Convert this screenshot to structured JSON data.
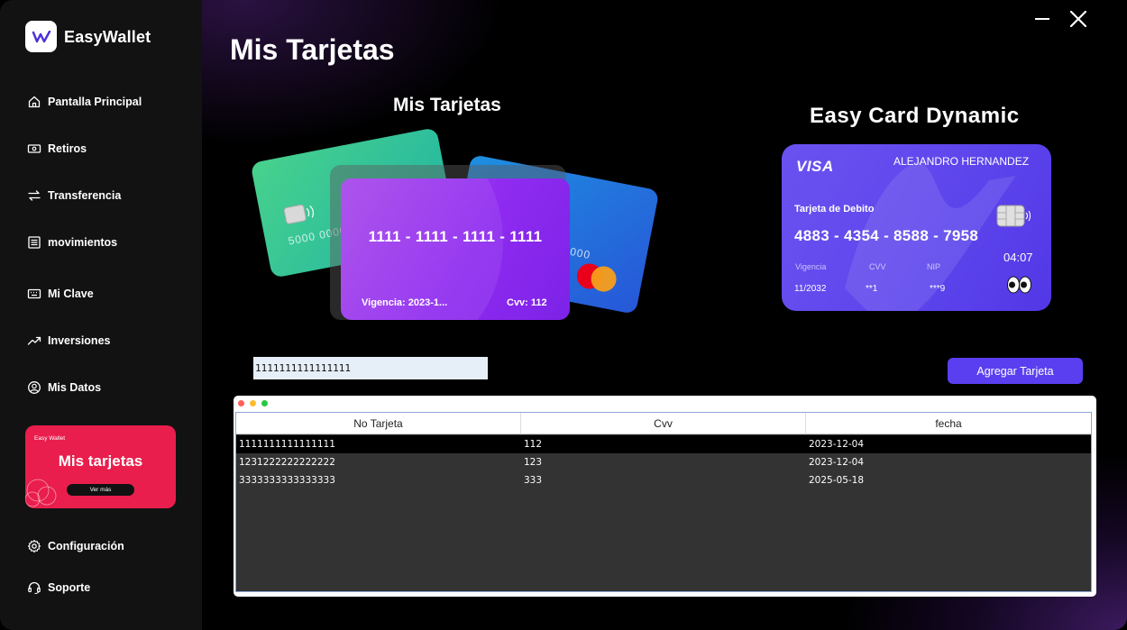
{
  "app": {
    "name": "EasyWallet"
  },
  "sidebar": {
    "items": [
      {
        "label": "Pantalla Principal",
        "icon": "home-icon"
      },
      {
        "label": "Retiros",
        "icon": "cash-icon"
      },
      {
        "label": "Transferencia",
        "icon": "transfer-icon"
      },
      {
        "label": "movimientos",
        "icon": "list-icon"
      },
      {
        "label": "Mi Clave",
        "icon": "keyboard-icon"
      },
      {
        "label": "Inversiones",
        "icon": "trending-up-icon"
      },
      {
        "label": "Mis Datos",
        "icon": "user-circle-icon"
      }
    ],
    "promo": {
      "brand": "Easy Wallet",
      "title": "Mis tarjetas",
      "button": "Ver más"
    },
    "bottom": [
      {
        "label": "Configuración",
        "icon": "gear-icon"
      },
      {
        "label": "Soporte",
        "icon": "headset-icon"
      }
    ]
  },
  "main": {
    "title": "Mis Tarjetas",
    "cards_title": "Mis Tarjetas",
    "dynamic_title": "Easy Card Dynamic"
  },
  "selected_card": {
    "number": "1111 - 1111 - 1111 - 1111",
    "vigencia": "Vigencia: 2023-1...",
    "cvv": "Cvv: 112"
  },
  "background_cards": {
    "green_number": "5000  0000",
    "blue_number": "0000"
  },
  "easy_card": {
    "brand": "VISA",
    "holder": "ALEJANDRO HERNANDEZ",
    "type": "Tarjeta de Debito",
    "number": "4883 - 4354 - 8588 - 7958",
    "time": "04:07",
    "labels": {
      "vigencia": "Vigencia",
      "cvv": "CVV",
      "nip": "NIP"
    },
    "values": {
      "vigencia": "11/2032",
      "cvv": "**1",
      "nip": "***9"
    }
  },
  "form": {
    "card_input_value": "1111111111111111",
    "add_button": "Agregar Tarjeta"
  },
  "table": {
    "headers": [
      "No Tarjeta",
      "Cvv",
      "fecha"
    ],
    "rows": [
      [
        "1111111111111111",
        "112",
        "2023-12-04"
      ],
      [
        "1231222222222222",
        "123",
        "2023-12-04"
      ],
      [
        "3333333333333333",
        "333",
        "2025-05-18"
      ]
    ]
  },
  "colors": {
    "accent": "#5a3ff0",
    "promo": "#e91e4d",
    "sidebar": "#121212",
    "selected_row": "#000000",
    "row": "#333333"
  }
}
